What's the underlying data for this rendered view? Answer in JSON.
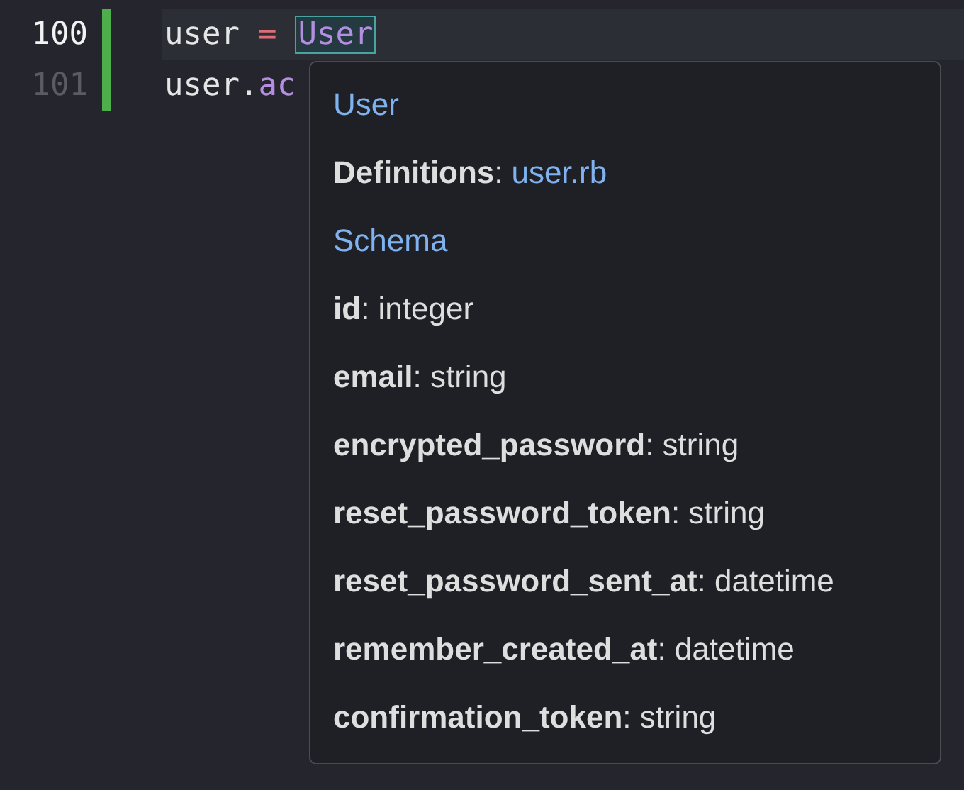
{
  "editor": {
    "lines": [
      {
        "number": "100",
        "active": true,
        "tokens": [
          {
            "text": "user",
            "kind": "plain"
          },
          {
            "text": "=",
            "kind": "operator"
          },
          {
            "text": "User",
            "kind": "match"
          }
        ]
      },
      {
        "number": "101",
        "active": false,
        "tokens": [
          {
            "text": "user.",
            "kind": "plain"
          },
          {
            "text": "ac",
            "kind": "method"
          }
        ]
      }
    ]
  },
  "popup": {
    "items": [
      {
        "kind": "heading",
        "text": "User"
      },
      {
        "kind": "definition",
        "label": "**Definitions**:",
        "link": "user.rb"
      },
      {
        "kind": "heading",
        "text": "Schema"
      },
      {
        "kind": "field",
        "text": "**id**: integer"
      },
      {
        "kind": "field",
        "text": "**email**: string"
      },
      {
        "kind": "field",
        "text": "**encrypted_password**: string"
      },
      {
        "kind": "field",
        "text": "**reset_password_token**: string"
      },
      {
        "kind": "field",
        "text": "**reset_password_sent_at**: datetime"
      },
      {
        "kind": "field",
        "text": "**remember_created_at**: datetime"
      },
      {
        "kind": "field",
        "text": "**confirmation_token**: string"
      }
    ]
  }
}
